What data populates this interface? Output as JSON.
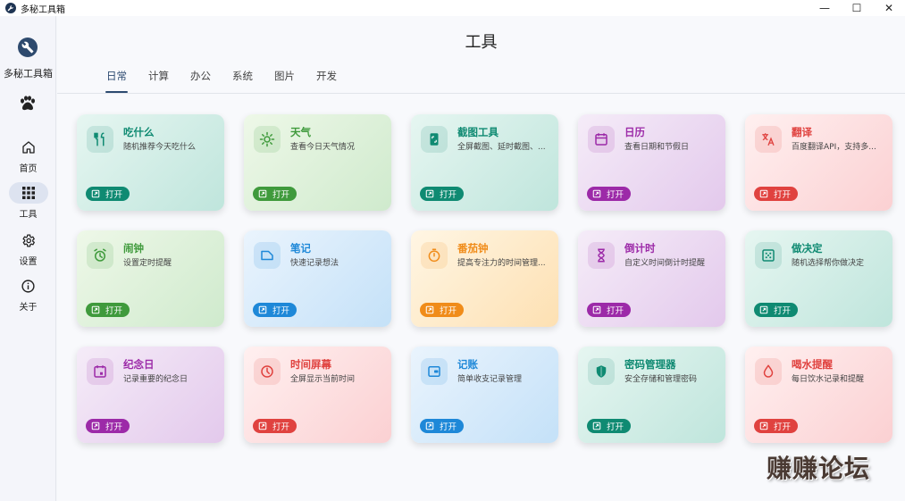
{
  "window": {
    "title": "多秘工具箱",
    "controls": [
      "—",
      "☐",
      "✕"
    ]
  },
  "sidebar": {
    "brand": "多秘工具箱",
    "items": [
      {
        "label": "首页",
        "icon": "home-icon"
      },
      {
        "label": "工具",
        "icon": "grid-icon",
        "active": true
      },
      {
        "label": "设置",
        "icon": "gear-icon"
      },
      {
        "label": "关于",
        "icon": "info-icon"
      }
    ]
  },
  "main": {
    "title": "工具",
    "tabs": [
      {
        "label": "日常",
        "active": true
      },
      {
        "label": "计算"
      },
      {
        "label": "办公"
      },
      {
        "label": "系统"
      },
      {
        "label": "图片"
      },
      {
        "label": "开发"
      }
    ],
    "open_label": "打开",
    "tools": [
      {
        "name": "吃什么",
        "desc": "随机推荐今天吃什么",
        "icon": "fork-knife-icon",
        "theme": "teal",
        "color": "#0f8a72"
      },
      {
        "name": "天气",
        "desc": "查看今日天气情况",
        "icon": "sun-icon",
        "theme": "green",
        "color": "#3f9a3c"
      },
      {
        "name": "截图工具",
        "desc": "全屏截图、延时截图、...",
        "icon": "screenshot-icon",
        "theme": "teal",
        "color": "#0f8a72"
      },
      {
        "name": "日历",
        "desc": "查看日期和节假日",
        "icon": "calendar-icon",
        "theme": "purple",
        "color": "#9c2aa8"
      },
      {
        "name": "翻译",
        "desc": "百度翻译API，支持多...",
        "icon": "translate-icon",
        "theme": "red",
        "color": "#e0423f"
      },
      {
        "name": "闹钟",
        "desc": "设置定时提醒",
        "icon": "alarm-icon",
        "theme": "green",
        "color": "#3f9a3c"
      },
      {
        "name": "笔记",
        "desc": "快速记录想法",
        "icon": "note-icon",
        "theme": "blue",
        "color": "#1e88d8"
      },
      {
        "name": "番茄钟",
        "desc": "提高专注力的时间管理...",
        "icon": "timer-icon",
        "theme": "orange",
        "color": "#f08c1a"
      },
      {
        "name": "倒计时",
        "desc": "自定义时间倒计时提醒",
        "icon": "hourglass-icon",
        "theme": "purple",
        "color": "#9c2aa8"
      },
      {
        "name": "做决定",
        "desc": "随机选择帮你做决定",
        "icon": "dice-icon",
        "theme": "teal",
        "color": "#0f8a72"
      },
      {
        "name": "纪念日",
        "desc": "记录重要的纪念日",
        "icon": "event-icon",
        "theme": "purple",
        "color": "#9c2aa8"
      },
      {
        "name": "时间屏幕",
        "desc": "全屏显示当前时间",
        "icon": "clock-icon",
        "theme": "red",
        "color": "#e0423f"
      },
      {
        "name": "记账",
        "desc": "简单收支记录管理",
        "icon": "wallet-icon",
        "theme": "blue",
        "color": "#1e88d8"
      },
      {
        "name": "密码管理器",
        "desc": "安全存储和管理密码",
        "icon": "shield-icon",
        "theme": "teal",
        "color": "#0f8a72"
      },
      {
        "name": "喝水提醒",
        "desc": "每日饮水记录和提醒",
        "icon": "water-drop-icon",
        "theme": "red",
        "color": "#e0423f"
      }
    ]
  },
  "watermark": "赚赚论坛"
}
